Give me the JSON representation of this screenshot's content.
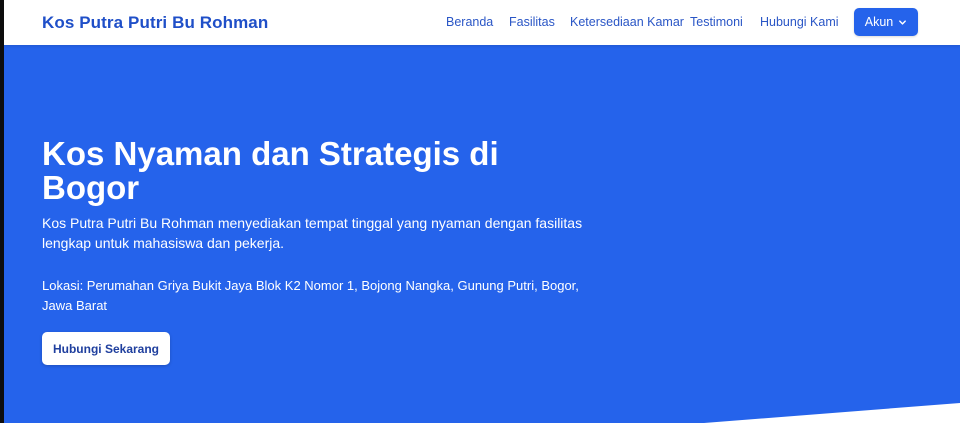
{
  "header": {
    "brand": "Kos Putra Putri Bu Rohman",
    "nav": [
      {
        "label": "Beranda"
      },
      {
        "label": "Fasilitas"
      },
      {
        "label": "Ketersediaan Kamar"
      },
      {
        "label": "Testimoni"
      },
      {
        "label": "Hubungi Kami"
      }
    ],
    "account_button": {
      "label": "Akun",
      "icon": "chevron-down-icon"
    }
  },
  "hero": {
    "title": "Kos Nyaman dan Strategis di Bogor",
    "description": "Kos Putra Putri Bu Rohman menyediakan tempat tinggal yang nyaman dengan fasilitas lengkap untuk mahasiswa dan pekerja.",
    "location": "Lokasi: Perumahan Griya Bukit Jaya Blok K2 Nomor 1, Bojong Nangka, Gunung Putri, Bogor, Jawa Barat",
    "cta_label": "Hubungi Sekarang"
  },
  "colors": {
    "primary": "#2563eb",
    "brand_text": "#1f4fc8",
    "nav_text": "#2a56c6",
    "hero_text": "#ffffff"
  }
}
